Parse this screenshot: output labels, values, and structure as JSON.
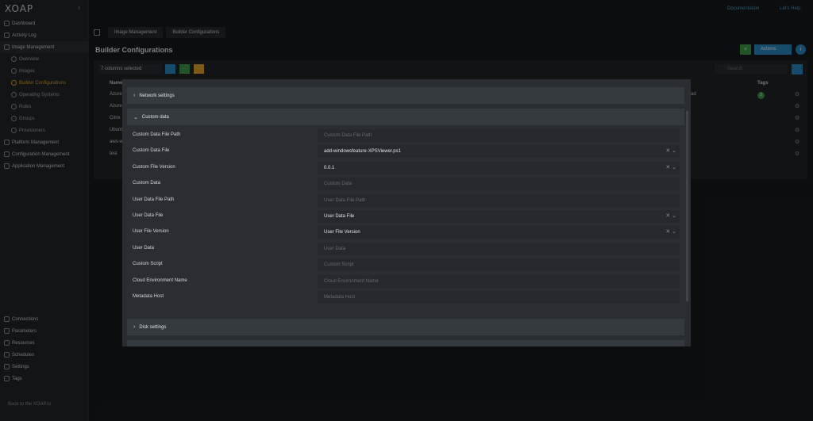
{
  "app": {
    "logo_text": "XOAP",
    "collapse_glyph": "‹"
  },
  "topbar": {
    "documentation": "Documentation",
    "user": "Let's Help"
  },
  "sidebar": {
    "main": [
      {
        "label": "Dashboard",
        "icon": "dashboard-icon"
      },
      {
        "label": "Activity Log",
        "icon": "activity-icon"
      },
      {
        "label": "Image Management",
        "icon": "image-icon"
      },
      {
        "label": "Overview",
        "icon": "overview-icon"
      },
      {
        "label": "Images",
        "icon": "images-icon"
      },
      {
        "label": "Builder Configurations",
        "icon": "builder-icon"
      },
      {
        "label": "Operating Systems",
        "icon": "os-icon"
      },
      {
        "label": "Roles",
        "icon": "roles-icon"
      },
      {
        "label": "Groups",
        "icon": "groups-icon"
      },
      {
        "label": "Provisioners",
        "icon": "provisioners-icon"
      },
      {
        "label": "Platform Management",
        "icon": "platform-icon"
      },
      {
        "label": "Configuration Management",
        "icon": "config-icon"
      },
      {
        "label": "Application Management",
        "icon": "app-icon"
      }
    ],
    "bottom": [
      {
        "label": "Connections",
        "icon": "connections-icon"
      },
      {
        "label": "Parameters",
        "icon": "parameters-icon"
      },
      {
        "label": "Resources",
        "icon": "resources-icon"
      },
      {
        "label": "Schedules",
        "icon": "schedules-icon"
      },
      {
        "label": "Settings",
        "icon": "settings-icon"
      },
      {
        "label": "Tags",
        "icon": "tags-icon"
      }
    ],
    "back_link": "Back to the XOAP.io"
  },
  "breadcrumb": [
    "Image Management",
    "Builder Configurations"
  ],
  "page": {
    "title": "Builder Configurations",
    "add_label": "+",
    "actions_label": "Actions",
    "info_label": "i"
  },
  "table": {
    "columns_selected": "7 columns selected",
    "search_placeholder": "Search",
    "header_name": "Name",
    "header_tags": "Tags",
    "rows": [
      "Azure",
      "Azure",
      "Citrix",
      "Ubuntu",
      "aws-w",
      "test"
    ],
    "row_suffix": "ad",
    "tag_count": "2"
  },
  "modal": {
    "sections": {
      "network": "Network settings",
      "custom": "Custom data",
      "disk": "Disk settings"
    },
    "fields": [
      {
        "label": "Custom Data File Path",
        "value": "",
        "placeholder": "Custom Data File Path",
        "clear": false
      },
      {
        "label": "Custom Data File",
        "value": "add-windowsfeature-XPSViewer.ps1",
        "placeholder": "",
        "clear": true
      },
      {
        "label": "Custom File Version",
        "value": "0.0.1",
        "placeholder": "",
        "clear": true
      },
      {
        "label": "Custom Data",
        "value": "",
        "placeholder": "Custom Data",
        "clear": false
      },
      {
        "label": "User Data File Path",
        "value": "",
        "placeholder": "User Data File Path",
        "clear": false
      },
      {
        "label": "User Data File",
        "value": "User Data File",
        "placeholder": "",
        "clear": true
      },
      {
        "label": "User File Version",
        "value": "User File Version",
        "placeholder": "",
        "clear": true
      },
      {
        "label": "User Data",
        "value": "",
        "placeholder": "User Data",
        "clear": false
      },
      {
        "label": "Custom Script",
        "value": "",
        "placeholder": "Custom Script",
        "clear": false
      },
      {
        "label": "Cloud Environment Name",
        "value": "",
        "placeholder": "Cloud Environment Name",
        "clear": false
      },
      {
        "label": "Metadata Host",
        "value": "",
        "placeholder": "Metadata Host",
        "clear": false
      }
    ]
  },
  "colors": {
    "accent": "#2a89c4",
    "active": "#e0a72b",
    "success": "#3c9b47"
  }
}
